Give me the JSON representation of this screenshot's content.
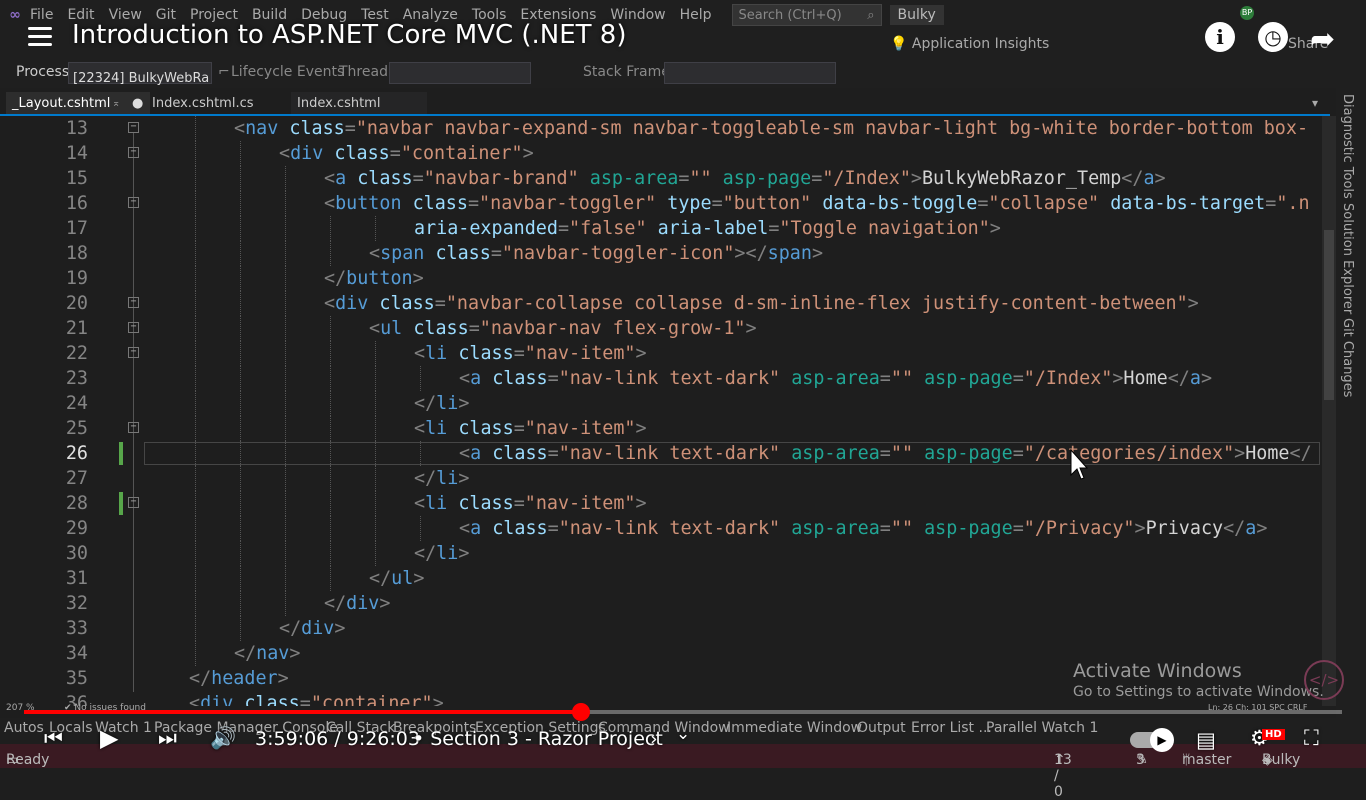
{
  "menubar": {
    "items": [
      "File",
      "Edit",
      "View",
      "Git",
      "Project",
      "Build",
      "Debug",
      "Test",
      "Analyze",
      "Tools",
      "Extensions",
      "Window",
      "Help"
    ],
    "search_placeholder": "Search (Ctrl+Q)",
    "solution_name": "Bulky",
    "account_initials": "BP"
  },
  "toolbar": {
    "app_insights": "Application Insights",
    "share": "Share"
  },
  "debugbar": {
    "process_label": "Process:",
    "process_value": "[22324] BulkyWebRa",
    "lifecycle": "Lifecycle Events",
    "thread_label": "Thread:",
    "stack_label": "Stack Frame:"
  },
  "tabs": [
    {
      "label": "_Layout.cshtml",
      "active": true
    },
    {
      "label": "Index.cshtml.cs",
      "active": false
    },
    {
      "label": "Index.cshtml",
      "active": false
    }
  ],
  "editor": {
    "zoom": "207 %",
    "issues": "No issues found",
    "position": "Ln: 26     Ch: 101     SPC     CRLF",
    "current_line": 26
  },
  "code_lines": [
    {
      "n": "13",
      "code": "<nav class=\"navbar navbar-expand-sm navbar-toggleable-sm navbar-light bg-white border-bottom box-"
    },
    {
      "n": "14",
      "code": "<div class=\"container\">"
    },
    {
      "n": "15",
      "code": "<a class=\"navbar-brand\" asp-area=\"\" asp-page=\"/Index\">BulkyWebRazor_Temp</a>"
    },
    {
      "n": "16",
      "code": "<button class=\"navbar-toggler\" type=\"button\" data-bs-toggle=\"collapse\" data-bs-target=\".n"
    },
    {
      "n": "17",
      "code": "aria-expanded=\"false\" aria-label=\"Toggle navigation\">"
    },
    {
      "n": "18",
      "code": "<span class=\"navbar-toggler-icon\"></span>"
    },
    {
      "n": "19",
      "code": "</button>"
    },
    {
      "n": "20",
      "code": "<div class=\"navbar-collapse collapse d-sm-inline-flex justify-content-between\">"
    },
    {
      "n": "21",
      "code": "<ul class=\"navbar-nav flex-grow-1\">"
    },
    {
      "n": "22",
      "code": "<li class=\"nav-item\">"
    },
    {
      "n": "23",
      "code": "<a class=\"nav-link text-dark\" asp-area=\"\" asp-page=\"/Index\">Home</a>"
    },
    {
      "n": "24",
      "code": "</li>"
    },
    {
      "n": "25",
      "code": "<li class=\"nav-item\">"
    },
    {
      "n": "26",
      "code": "<a class=\"nav-link text-dark\" asp-area=\"\" asp-page=\"/categories/index\">Home</"
    },
    {
      "n": "27",
      "code": "</li>"
    },
    {
      "n": "28",
      "code": "<li class=\"nav-item\">"
    },
    {
      "n": "29",
      "code": "<a class=\"nav-link text-dark\" asp-area=\"\" asp-page=\"/Privacy\">Privacy</a>"
    },
    {
      "n": "30",
      "code": "</li>"
    },
    {
      "n": "31",
      "code": "</ul>"
    },
    {
      "n": "32",
      "code": "</div>"
    },
    {
      "n": "33",
      "code": "</div>"
    },
    {
      "n": "34",
      "code": "</nav>"
    },
    {
      "n": "35",
      "code": "</header>"
    },
    {
      "n": "36",
      "code": "<div class=\"container\">"
    }
  ],
  "side_panels": [
    "Diagnostic Tools",
    "Solution Explorer",
    "Git Changes"
  ],
  "bottom_tabs": [
    "Autos",
    "Locals",
    "Watch 1",
    "Package Manager Console",
    "Call Stack",
    "Breakpoints",
    "Exception Settings",
    "Command Window",
    "Immediate Window",
    "Output",
    "Error List ...",
    "Parallel Watch 1"
  ],
  "statusbar": {
    "ready": "Ready",
    "changes": "13 / 0",
    "edits": "3",
    "branch": "master",
    "repo": "Bulky"
  },
  "watermark": {
    "title": "Activate Windows",
    "subtitle": "Go to Settings to activate Windows."
  },
  "video": {
    "title": "Introduction to ASP.NET Core MVC (.NET 8)",
    "time": "3:59:06 / 9:26:03",
    "chapter": "• Section 3 - Razor Project",
    "progress_fraction": 0.4229,
    "buffered_fraction": 0.406,
    "hd": "HD"
  }
}
